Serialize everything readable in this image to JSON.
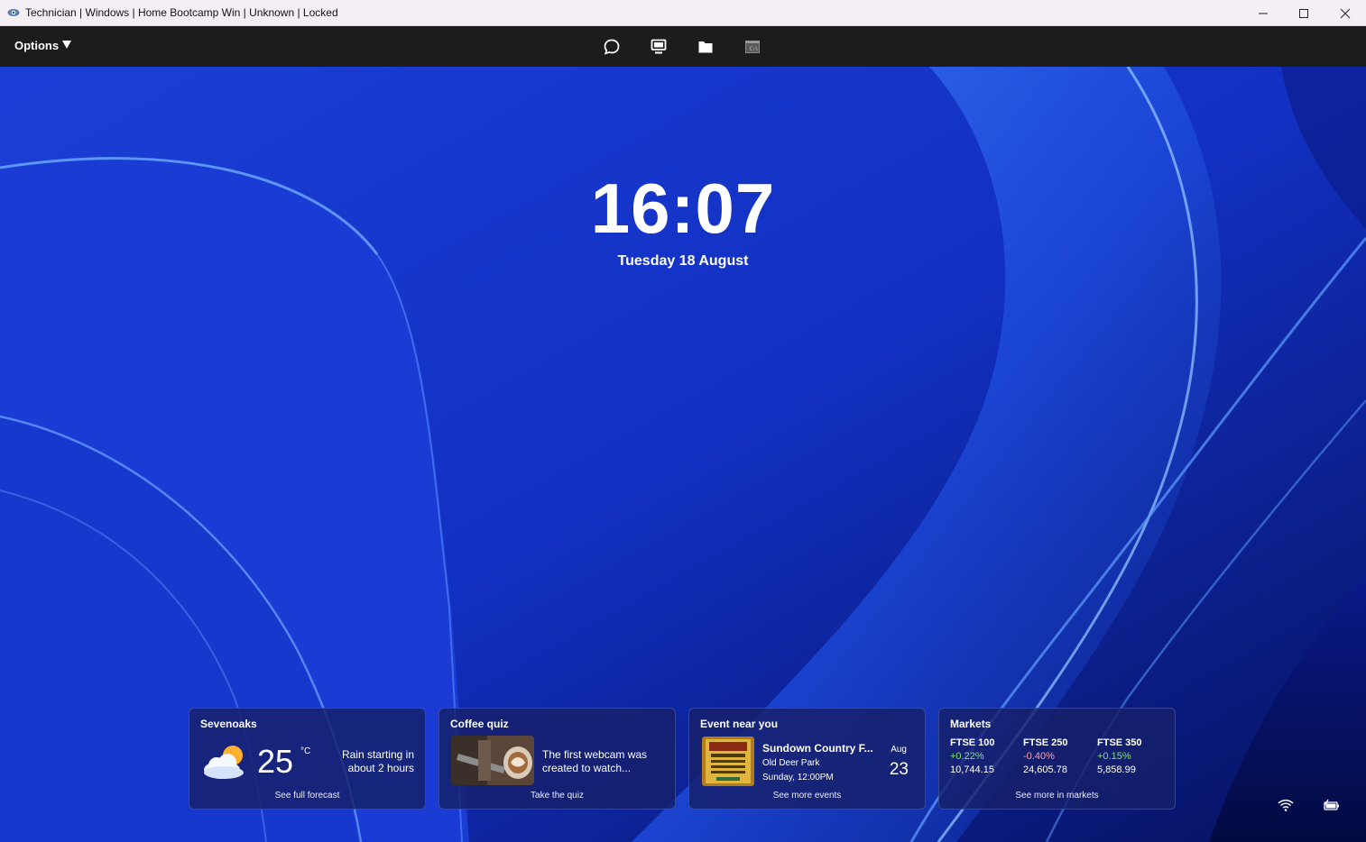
{
  "window": {
    "title": "Technician | Windows | Home Bootcamp Win | Unknown | Locked",
    "icons": [
      "eye-icon",
      "minimize-icon",
      "maximize-icon",
      "close-icon"
    ]
  },
  "toolbar": {
    "options_label": "Options",
    "icons": [
      "chat-icon",
      "monitor-icon",
      "folder-icon",
      "terminal-icon"
    ]
  },
  "lockscreen": {
    "time": "16:07",
    "date": "Tuesday 18 August"
  },
  "widgets": {
    "weather": {
      "title": "Sevenoaks",
      "temp": "25",
      "unit": "°C",
      "summary_line1": "Rain starting in",
      "summary_line2": "about 2 hours",
      "footer": "See full forecast",
      "icon": "partly-cloudy-icon"
    },
    "quiz": {
      "title": "Coffee quiz",
      "line1": "The first webcam was",
      "line2": "created to watch...",
      "footer": "Take the quiz"
    },
    "event": {
      "title": "Event near you",
      "name": "Sundown Country F...",
      "place": "Old Deer Park",
      "time": "Sunday, 12:00PM",
      "month": "Aug",
      "day": "23",
      "footer": "See more events"
    },
    "markets": {
      "title": "Markets",
      "items": [
        {
          "name": "FTSE 100",
          "change": "+0.22%",
          "value": "10,744.15",
          "direction": "up"
        },
        {
          "name": "FTSE 250",
          "change": "-0.40%",
          "value": "24,605.78",
          "direction": "down"
        },
        {
          "name": "FTSE 350",
          "change": "+0.15%",
          "value": "5,858.99",
          "direction": "up"
        }
      ],
      "footer": "See more in markets"
    }
  },
  "system_tray": {
    "icons": [
      "wifi-icon",
      "battery-charging-icon"
    ]
  },
  "colors": {
    "titlebar": "#f6eef5",
    "toolbar": "#1c1c1c",
    "desktop": "#1531c6",
    "card": "#16206a",
    "up": "#7ee27c",
    "down": "#ff9bb0"
  }
}
